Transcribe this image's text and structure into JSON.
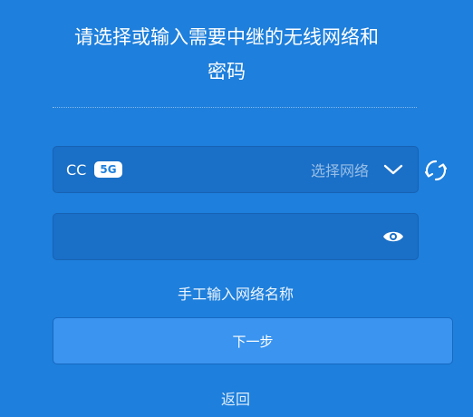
{
  "header": {
    "title_line1": "请选择或输入需要中继的无线网络和",
    "title_line2": "密码"
  },
  "network": {
    "ssid": "CC",
    "band": "5G",
    "select_hint": "选择网络",
    "dropdown_icon": "chevron-down-icon",
    "refresh_icon": "refresh-icon"
  },
  "password": {
    "value": "",
    "placeholder": "",
    "toggle_icon": "eye-icon"
  },
  "links": {
    "manual_input": "手工输入网络名称",
    "back": "返回"
  },
  "actions": {
    "next_label": "下一步"
  },
  "colors": {
    "background": "#1e7fdc",
    "field_background": "#1a6fc7",
    "button_background": "#3a94f0",
    "badge_text": "#1e7fdc"
  }
}
